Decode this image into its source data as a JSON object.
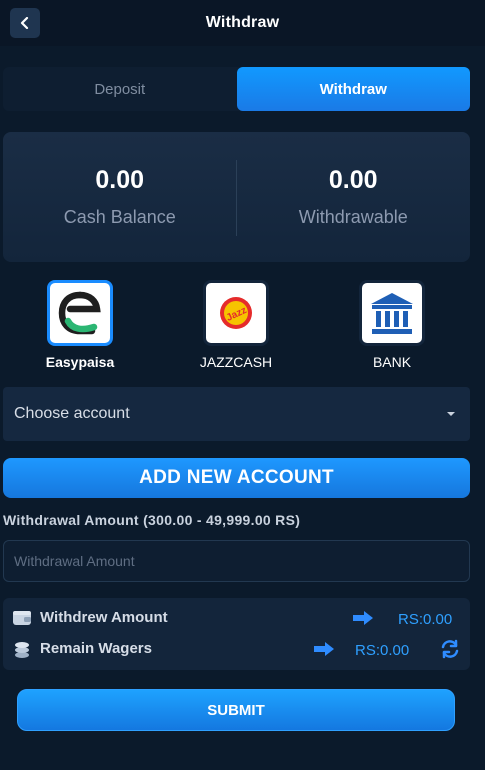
{
  "header": {
    "title": "Withdraw",
    "back_icon": "chevron-left-icon"
  },
  "tabs": [
    {
      "label": "Deposit",
      "active": false
    },
    {
      "label": "Withdraw",
      "active": true
    }
  ],
  "balances": {
    "cash": {
      "value": "0.00",
      "label": "Cash Balance"
    },
    "withdrawable": {
      "value": "0.00",
      "label": "Withdrawable"
    }
  },
  "methods": [
    {
      "label": "Easypaisa",
      "icon": "easypaisa-logo-icon",
      "selected": true
    },
    {
      "label": "JAZZCASH",
      "icon": "jazzcash-logo-icon",
      "selected": false
    },
    {
      "label": "BANK",
      "icon": "bank-icon",
      "selected": false
    }
  ],
  "account_select": {
    "value": "Choose account"
  },
  "add_account": {
    "label": "ADD NEW ACCOUNT"
  },
  "amount": {
    "label": "Withdrawal Amount (300.00 - 49,999.00 RS)",
    "placeholder": "Withdrawal Amount"
  },
  "info": {
    "withdrew": {
      "label": "Withdrew Amount",
      "value": "RS:0.00"
    },
    "wagers": {
      "label": "Remain Wagers",
      "value": "RS:0.00"
    }
  },
  "submit": {
    "label": "SUBMIT"
  },
  "colors": {
    "accent": "#1a8cff",
    "background": "#0b1a2b",
    "card": "#13253b"
  }
}
